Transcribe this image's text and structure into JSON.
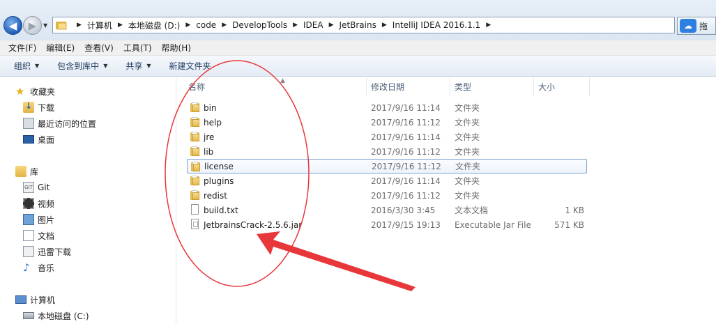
{
  "address": {
    "crumbs": [
      "计算机",
      "本地磁盘 (D:)",
      "code",
      "DevelopTools",
      "IDEA",
      "JetBrains",
      "IntelliJ IDEA 2016.1.1"
    ],
    "right_label": "拖"
  },
  "menu": [
    "文件(F)",
    "编辑(E)",
    "查看(V)",
    "工具(T)",
    "帮助(H)"
  ],
  "commands": [
    {
      "label": "组织",
      "dropdown": true
    },
    {
      "label": "包含到库中",
      "dropdown": true
    },
    {
      "label": "共享",
      "dropdown": true
    },
    {
      "label": "新建文件夹",
      "dropdown": false
    }
  ],
  "sidebar": {
    "favorites": {
      "label": "收藏夹",
      "items": [
        "下载",
        "最近访问的位置",
        "桌面"
      ]
    },
    "libraries": {
      "label": "库",
      "items": [
        "Git",
        "视频",
        "图片",
        "文档",
        "迅雷下载",
        "音乐"
      ]
    },
    "computer": {
      "label": "计算机",
      "items": [
        "本地磁盘 (C:)"
      ]
    }
  },
  "columns": {
    "name": "名称",
    "date": "修改日期",
    "type": "类型",
    "size": "大小"
  },
  "files": [
    {
      "name": "bin",
      "date": "2017/9/16 11:14",
      "type": "文件夹",
      "size": "",
      "kind": "folder"
    },
    {
      "name": "help",
      "date": "2017/9/16 11:12",
      "type": "文件夹",
      "size": "",
      "kind": "folder"
    },
    {
      "name": "jre",
      "date": "2017/9/16 11:14",
      "type": "文件夹",
      "size": "",
      "kind": "folder"
    },
    {
      "name": "lib",
      "date": "2017/9/16 11:12",
      "type": "文件夹",
      "size": "",
      "kind": "folder"
    },
    {
      "name": "license",
      "date": "2017/9/16 11:12",
      "type": "文件夹",
      "size": "",
      "kind": "folder",
      "selected": true
    },
    {
      "name": "plugins",
      "date": "2017/9/16 11:14",
      "type": "文件夹",
      "size": "",
      "kind": "folder"
    },
    {
      "name": "redist",
      "date": "2017/9/16 11:12",
      "type": "文件夹",
      "size": "",
      "kind": "folder"
    },
    {
      "name": "build.txt",
      "date": "2016/3/30 3:45",
      "type": "文本文档",
      "size": "1 KB",
      "kind": "txt"
    },
    {
      "name": "JetbrainsCrack-2.5.6.jar",
      "date": "2017/9/15 19:13",
      "type": "Executable Jar File",
      "size": "571 KB",
      "kind": "jar"
    }
  ],
  "colors": {
    "annotation": "#e8373a",
    "selection_border": "#7da2ce"
  }
}
